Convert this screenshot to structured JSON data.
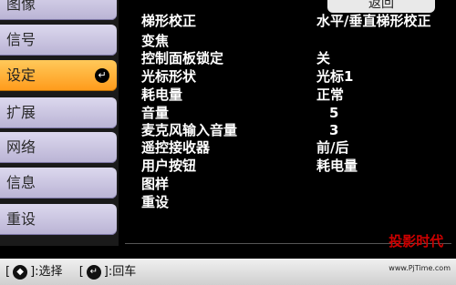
{
  "sidebar": {
    "items": [
      {
        "label": "图像"
      },
      {
        "label": "信号"
      },
      {
        "label": "设定"
      },
      {
        "label": "扩展"
      },
      {
        "label": "网络"
      },
      {
        "label": "信息"
      },
      {
        "label": "重设"
      }
    ]
  },
  "panel": {
    "back_label": "返回",
    "rows": [
      {
        "label": "梯形校正",
        "value": "水平/垂直梯形校正"
      },
      {
        "label": "变焦",
        "value": ""
      },
      {
        "label": "控制面板锁定",
        "value": "关"
      },
      {
        "label": "光标形状",
        "value": "光标1"
      },
      {
        "label": "耗电量",
        "value": "正常"
      },
      {
        "label": "音量",
        "value": "5"
      },
      {
        "label": "麦克风输入音量",
        "value": "3"
      },
      {
        "label": "遥控接收器",
        "value": "前/后"
      },
      {
        "label": "用户按钮",
        "value": "耗电量"
      },
      {
        "label": "图样",
        "value": ""
      },
      {
        "label": "重设",
        "value": ""
      }
    ]
  },
  "footer": {
    "select_key": "◆",
    "select_label": ":选择",
    "enter_key": "↵",
    "enter_label": ":回车"
  },
  "brand": {
    "name": "投影时代",
    "url": "www.PjTime.com"
  },
  "colors": {
    "active_tab": "#ff9a1a",
    "inactive_tab": "#c9c3e2",
    "panel_bg": "#000000"
  }
}
